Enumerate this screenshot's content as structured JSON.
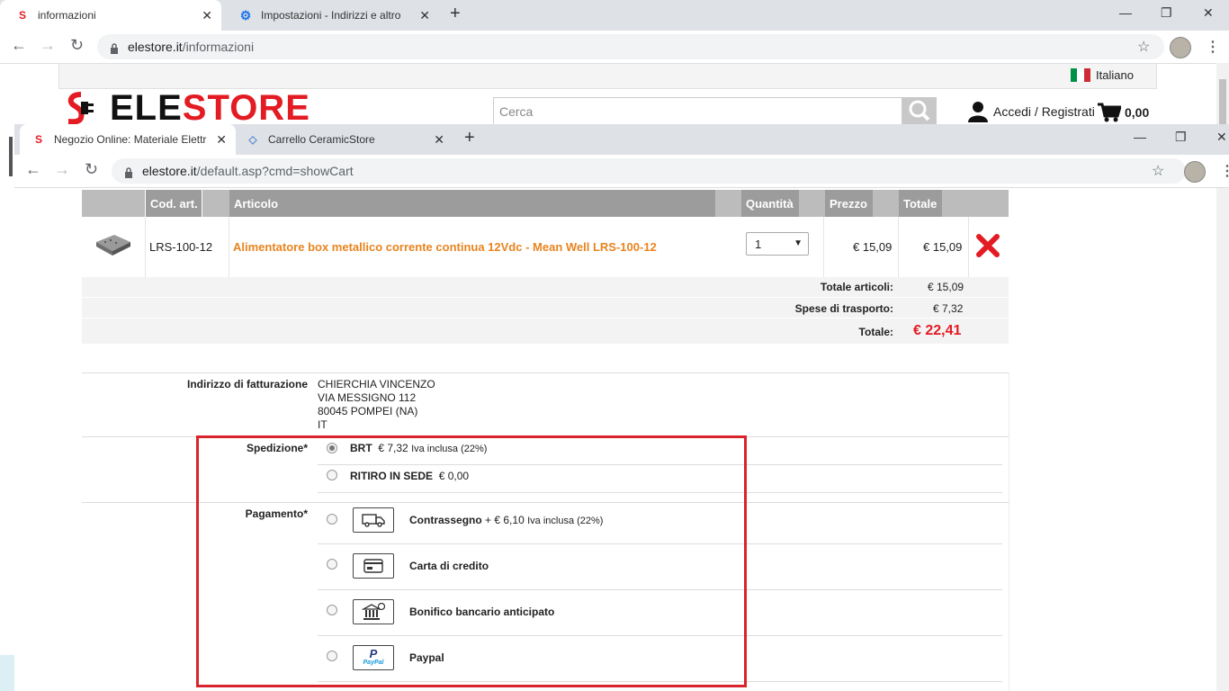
{
  "outer_browser": {
    "tabs": [
      {
        "title": "informazioni",
        "active": true
      },
      {
        "title": "Impostazioni - Indirizzi e altro",
        "active": false
      }
    ],
    "url_host": "elestore.it",
    "url_path": "/informazioni"
  },
  "store_header": {
    "language": "Italiano",
    "logo_part1": "ELE",
    "logo_part2": "STORE",
    "search_placeholder": "Cerca",
    "login_label": "Accedi / Registrati",
    "cart_total": "0,00"
  },
  "inner_browser": {
    "tabs": [
      {
        "title": "Negozio Online: Materiale Elettri",
        "active": true
      },
      {
        "title": "Carrello CeramicStore",
        "active": false
      }
    ],
    "url_host": "elestore.it",
    "url_path": "/default.asp?cmd=showCart"
  },
  "cart": {
    "columns": [
      "Cod. art.",
      "Articolo",
      "Quantità",
      "Prezzo",
      "Totale"
    ],
    "items": [
      {
        "code": "LRS-100-12",
        "name": "Alimentatore box metallico corrente continua 12Vdc - Mean Well LRS-100-12",
        "quantity": "1",
        "price": "€ 15,09",
        "total": "€ 15,09"
      }
    ],
    "summary": {
      "items_label": "Totale articoli:",
      "items_value": "€ 15,09",
      "shipping_label": "Spese di trasporto:",
      "shipping_value": "€ 7,32",
      "total_label": "Totale:",
      "total_value": "€ 22,41"
    }
  },
  "billing": {
    "label": "Indirizzo di fatturazione",
    "line1": "CHIERCHIA VINCENZO",
    "line2": "VIA MESSIGNO 112",
    "line3": "80045 POMPEI (NA)",
    "line4": "IT"
  },
  "shipping": {
    "label": "Spedizione*",
    "options": [
      {
        "name": "BRT",
        "price": "€ 7,32",
        "note": "Iva inclusa (22%)",
        "selected": true
      },
      {
        "name": "RITIRO IN SEDE",
        "price": "€ 0,00",
        "note": "",
        "selected": false
      }
    ]
  },
  "payment": {
    "label": "Pagamento*",
    "options": [
      {
        "name": "Contrassegno",
        "price": "+ € 6,10",
        "note": "Iva inclusa (22%)",
        "icon": "truck-icon"
      },
      {
        "name": "Carta di credito",
        "price": "",
        "note": "",
        "icon": "credit-card-icon"
      },
      {
        "name": "Bonifico bancario anticipato",
        "price": "",
        "note": "",
        "icon": "bank-icon"
      },
      {
        "name": "Paypal",
        "price": "",
        "note": "",
        "icon": "paypal-icon"
      }
    ],
    "paypal_text": "PayPal"
  },
  "colors": {
    "accent_red": "#e31b23",
    "orange_link": "#e8841f",
    "highlight_box": "#d9232d",
    "header_gray": "#9c9c9c"
  }
}
